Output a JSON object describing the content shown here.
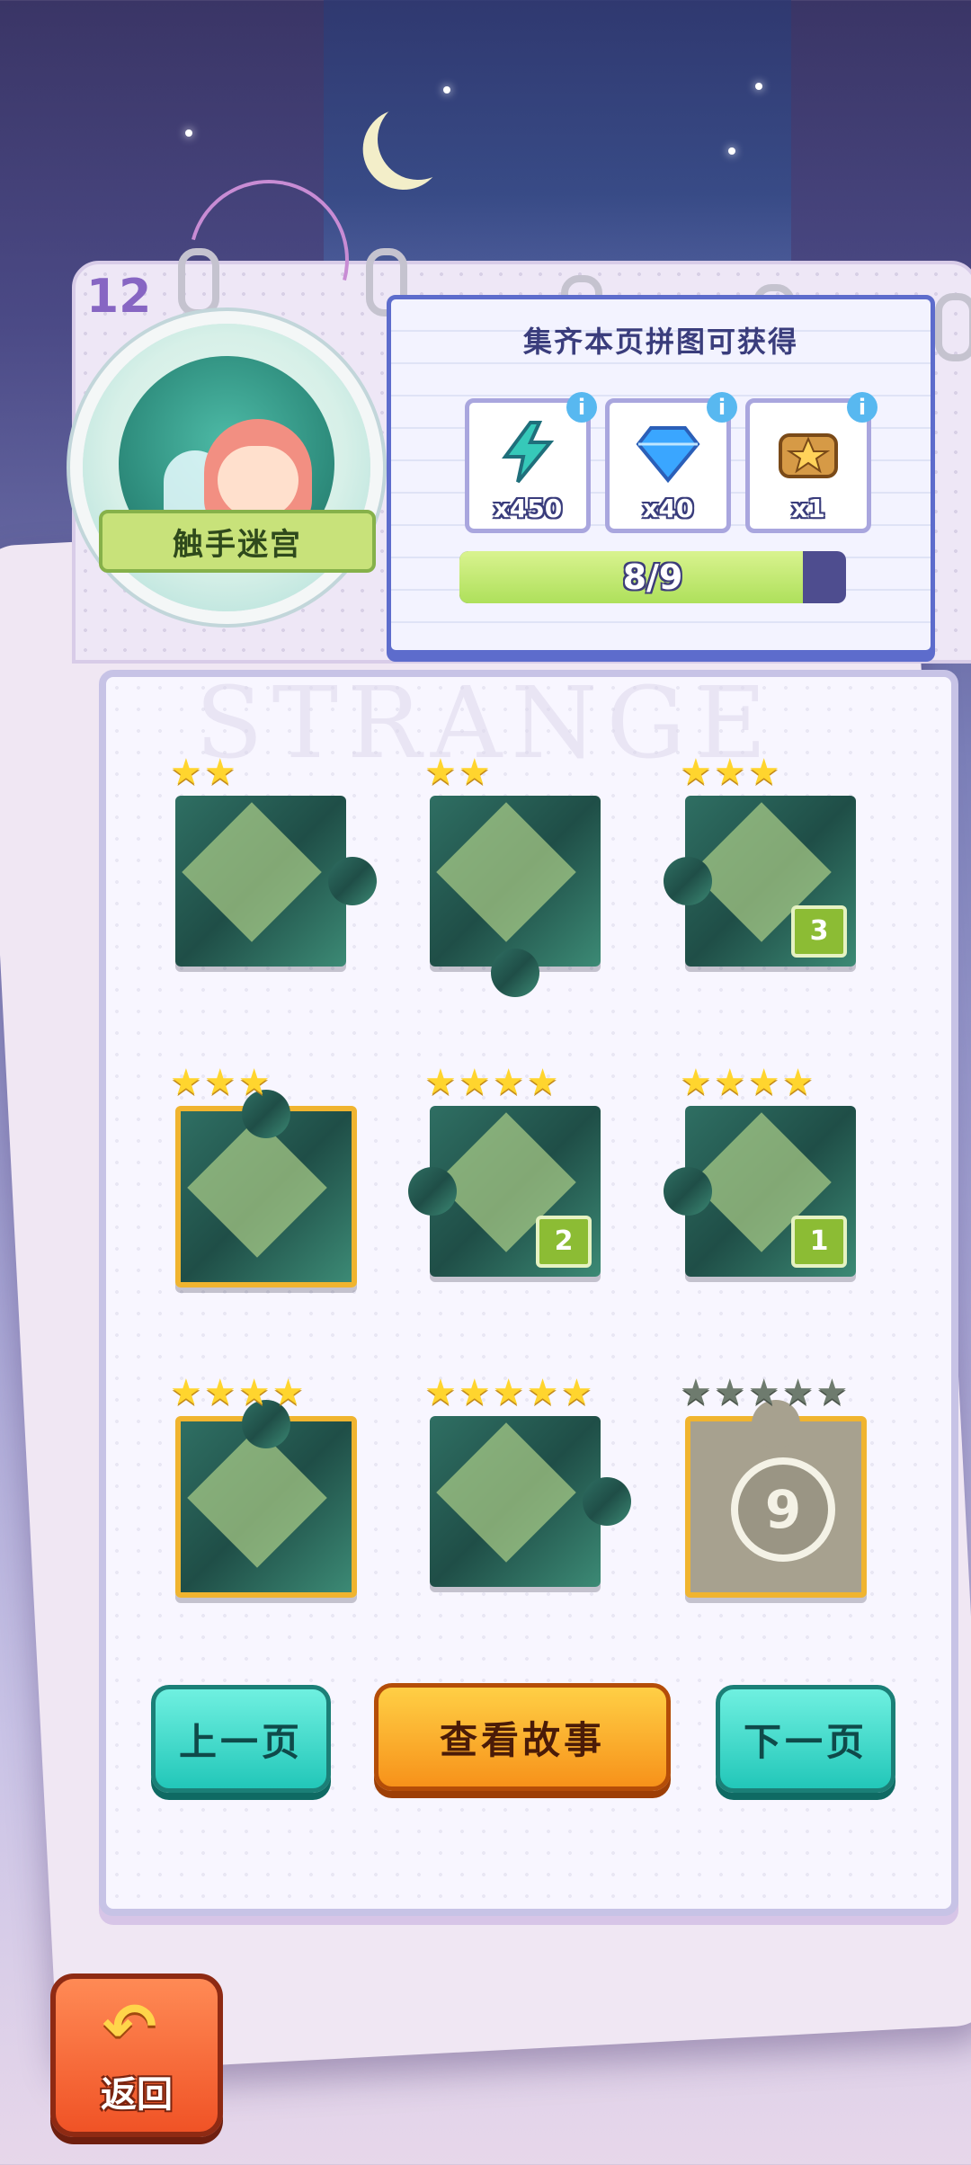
{
  "page_number": "12",
  "level": {
    "name": "触手迷宫"
  },
  "rewards": {
    "title": "集齐本页拼图可获得",
    "items": [
      {
        "name": "energy-bolt",
        "count": "x450",
        "color": "#36c9b9"
      },
      {
        "name": "diamond",
        "count": "x40",
        "color": "#3aa6ff"
      },
      {
        "name": "treasure-chest",
        "count": "x1",
        "color": "#d69a46"
      }
    ],
    "progress": {
      "text": "8/9",
      "collected": 8,
      "total": 9
    }
  },
  "watermark": "STRANGE",
  "pieces": [
    {
      "id": 1,
      "stars": 2,
      "stars_total": 2,
      "count": "",
      "style": "normal"
    },
    {
      "id": 2,
      "stars": 2,
      "stars_total": 2,
      "count": "",
      "style": "normal"
    },
    {
      "id": 3,
      "stars": 3,
      "stars_total": 3,
      "count": "3",
      "style": "normal"
    },
    {
      "id": 4,
      "stars": 3,
      "stars_total": 3,
      "count": "",
      "style": "gold"
    },
    {
      "id": 5,
      "stars": 4,
      "stars_total": 4,
      "count": "2",
      "style": "normal"
    },
    {
      "id": 6,
      "stars": 4,
      "stars_total": 4,
      "count": "1",
      "style": "normal"
    },
    {
      "id": 7,
      "stars": 4,
      "stars_total": 4,
      "count": "",
      "style": "gold"
    },
    {
      "id": 8,
      "stars": 5,
      "stars_total": 5,
      "count": "",
      "style": "normal"
    },
    {
      "id": 9,
      "stars": 0,
      "stars_total": 5,
      "count": "9",
      "style": "empty"
    }
  ],
  "buttons": {
    "prev": "上一页",
    "story": "查看故事",
    "next": "下一页",
    "back": "返回"
  },
  "colors": {
    "accent_teal": "#22c7b9",
    "accent_orange": "#f7921a",
    "gold": "#f0b42f"
  }
}
